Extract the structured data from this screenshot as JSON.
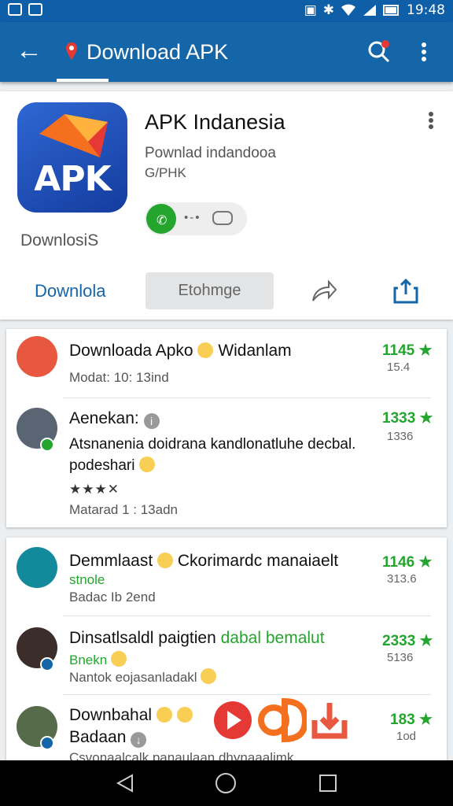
{
  "status_bar": {
    "time": "19:48"
  },
  "app_bar": {
    "title": "Download APK"
  },
  "hero": {
    "app_name": "APK Indanesia",
    "subtitle_1": "Pownlad indandooa",
    "subtitle_2": "G/PHK",
    "logo_caption": "DownlosiS",
    "logo_text": "APK",
    "toggle_label": "•-•",
    "primary_button": "Downlola",
    "secondary_button": "Etohmge"
  },
  "feed": [
    {
      "title": "Downloada Apko",
      "title_tail": "Widanlam",
      "meta": "Modat: 10: 13ind",
      "count": "1145 ★",
      "count_sub": "15.4"
    },
    {
      "title": "Aenekan:",
      "text_1": "Atsnanenia doidrana kandlonatluhe decbal.",
      "text_2": "podeshari",
      "stars": "★★★✕",
      "meta": "Matarad 1 : 13adn",
      "count": "1333 ★",
      "count_sub": "1336"
    },
    {
      "title": "Demmlaast",
      "title_tail": "Ckorimardc manaiaelt",
      "green": "stnole",
      "meta": "Badac Ib 2end",
      "count": "1146 ★",
      "count_sub": "313.6"
    },
    {
      "title": "Dinsatlsaldl paigtien",
      "title_green": "dabal bemalut",
      "green": "Bnekn",
      "meta": "Nantok eojasanladakl",
      "count": "2333 ★",
      "count_sub": "5136"
    },
    {
      "title": "Downbahal",
      "subtitle": "Badaan",
      "meta": "Csvonaalcalk panaulaan dhynaaalimk",
      "count": "183 ★",
      "count_sub": "1od"
    }
  ]
}
